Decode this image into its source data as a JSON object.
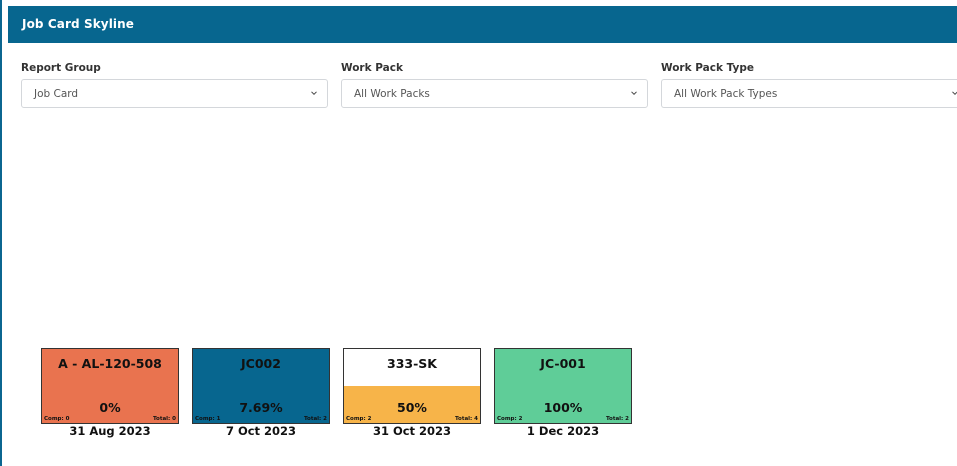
{
  "header": {
    "title": "Job Card Skyline"
  },
  "filters": [
    {
      "label": "Report Group",
      "value": "Job Card"
    },
    {
      "label": "Work Pack",
      "value": "All Work Packs"
    },
    {
      "label": "Work Pack Type",
      "value": "All Work Pack Types"
    }
  ],
  "icons": {
    "dropdown": "chevron-down-icon"
  },
  "colors": {
    "header_bg": "#07668f"
  },
  "tiles": [
    {
      "code": "A - AL-120-508",
      "percent": "0%",
      "progress": 0.0,
      "comp": "Comp: 0",
      "total": "Total: 0",
      "date": "31 Aug 2023",
      "bg": "#e9734f",
      "fill": "#e9734f"
    },
    {
      "code": "JC002",
      "percent": "7.69%",
      "progress": 0.0769,
      "comp": "Comp: 1",
      "total": "Total: 2",
      "date": "7 Oct 2023",
      "bg": "#07668f",
      "fill": "#07668f"
    },
    {
      "code": "333-SK",
      "percent": "50%",
      "progress": 0.5,
      "comp": "Comp: 2",
      "total": "Total: 4",
      "date": "31 Oct 2023",
      "bg": "#ffffff",
      "fill": "#f7b449"
    },
    {
      "code": "JC-001",
      "percent": "100%",
      "progress": 1.0,
      "comp": "Comp: 2",
      "total": "Total: 2",
      "date": "1 Dec 2023",
      "bg": "#5fcd98",
      "fill": "#5fcd98"
    }
  ]
}
